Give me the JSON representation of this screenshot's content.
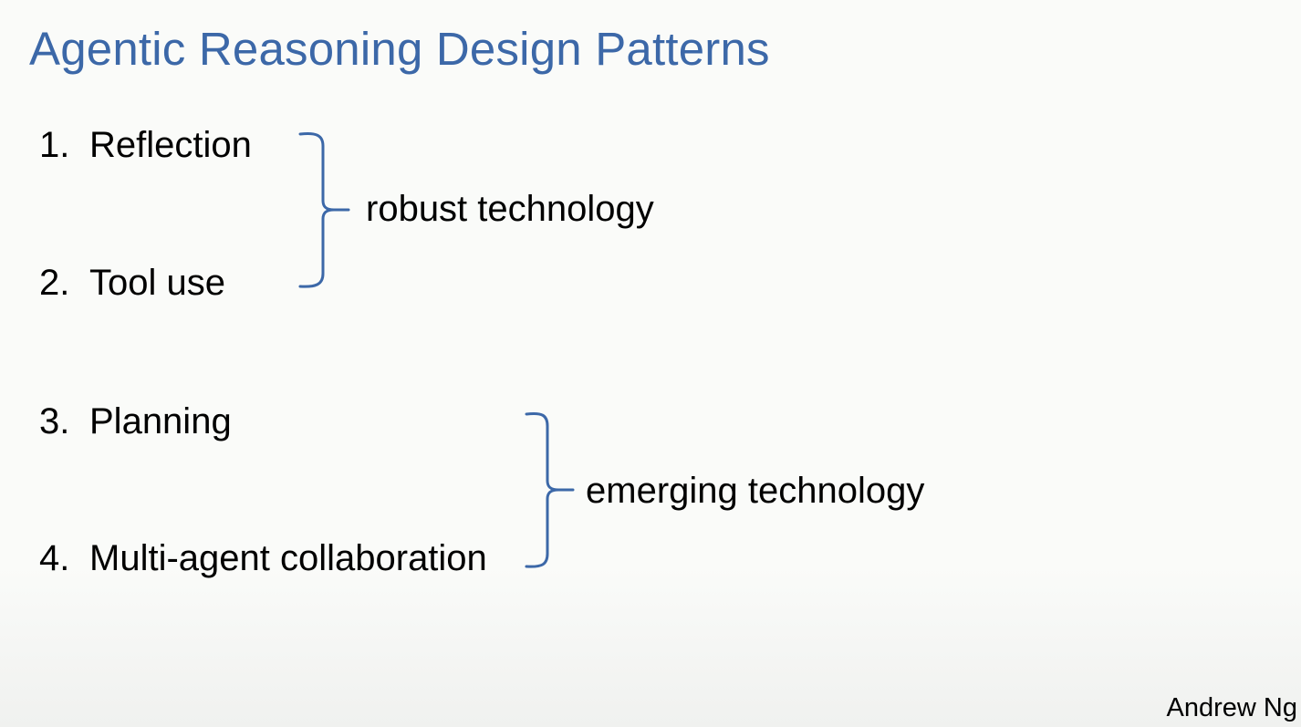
{
  "slide": {
    "title": "Agentic Reasoning Design Patterns",
    "items": [
      {
        "number": "1.",
        "label": "Reflection"
      },
      {
        "number": "2.",
        "label": "Tool use"
      },
      {
        "number": "3.",
        "label": "Planning"
      },
      {
        "number": "4.",
        "label": "Multi-agent collaboration"
      }
    ],
    "groups": [
      {
        "label": "robust technology"
      },
      {
        "label": "emerging technology"
      }
    ],
    "author": "Andrew Ng",
    "colors": {
      "title": "#3c68a8",
      "bracket": "#3c68a8",
      "background": "#fafbf9",
      "text": "#000000"
    },
    "icons": [
      "curly-brace-icon"
    ]
  }
}
